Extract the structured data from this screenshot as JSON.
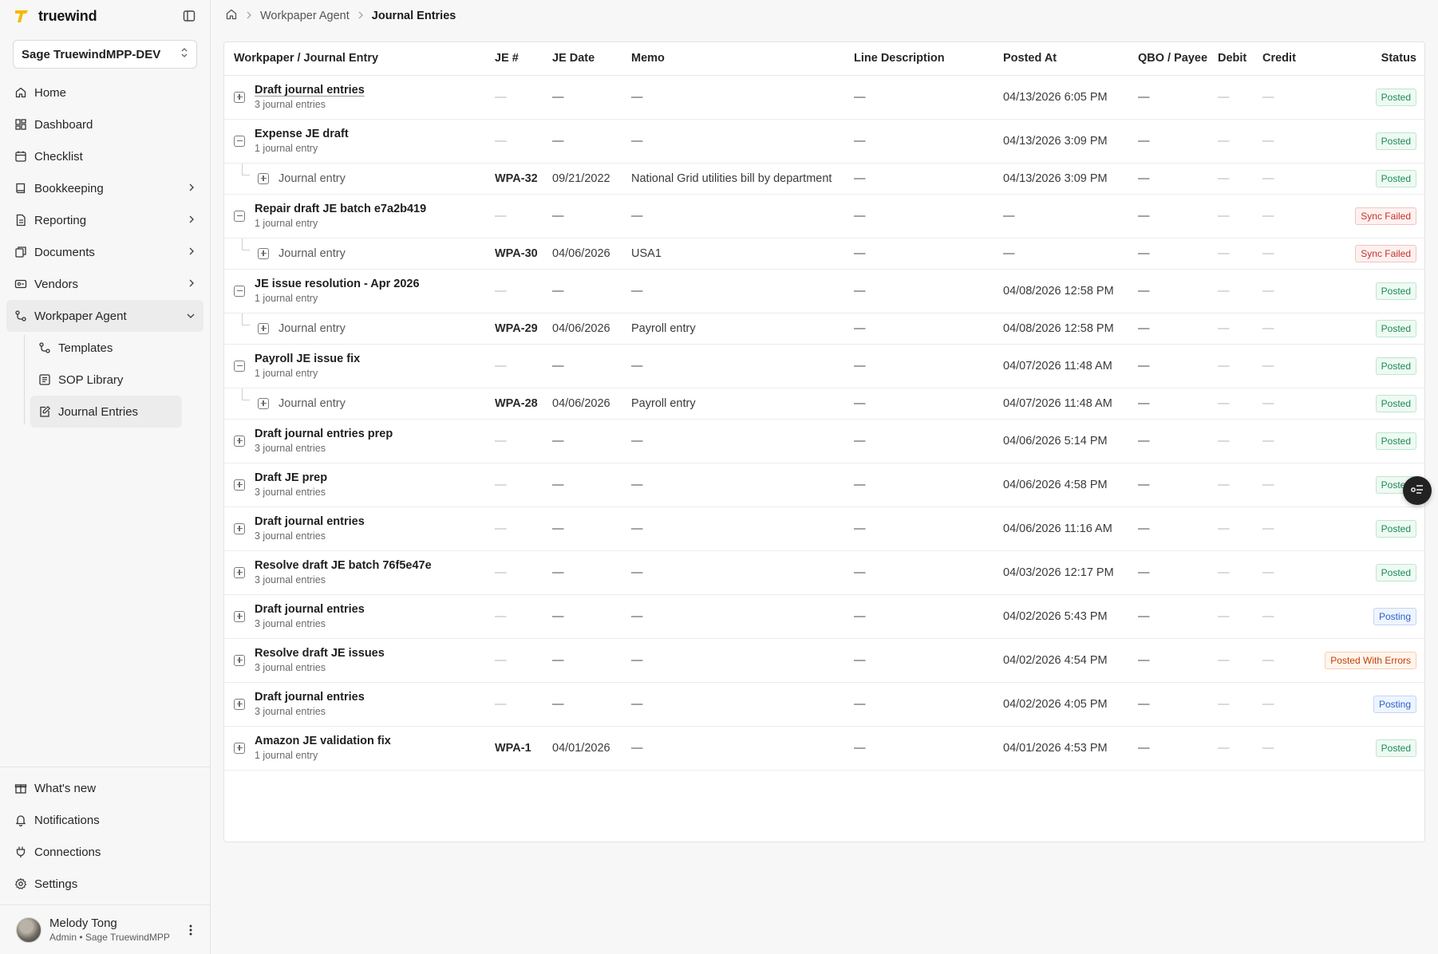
{
  "brand": {
    "name": "truewind",
    "accent": "#f5b800"
  },
  "org_select": {
    "value": "Sage TruewindMPP-DEV"
  },
  "nav": [
    {
      "label": "Home",
      "icon": "home-icon"
    },
    {
      "label": "Dashboard",
      "icon": "dashboard-icon"
    },
    {
      "label": "Checklist",
      "icon": "calendar-icon"
    },
    {
      "label": "Bookkeeping",
      "icon": "book-icon"
    },
    {
      "label": "Reporting",
      "icon": "report-icon"
    },
    {
      "label": "Documents",
      "icon": "documents-icon"
    },
    {
      "label": "Vendors",
      "icon": "vendors-icon"
    },
    {
      "label": "Workpaper Agent",
      "icon": "workpaper-agent-icon"
    }
  ],
  "subnav": [
    {
      "label": "Templates",
      "icon": "templates-icon"
    },
    {
      "label": "SOP Library",
      "icon": "sop-library-icon"
    },
    {
      "label": "Journal Entries",
      "icon": "journal-entries-icon"
    }
  ],
  "bottom_nav": [
    {
      "label": "What's new",
      "icon": "gift-icon"
    },
    {
      "label": "Notifications",
      "icon": "bell-icon"
    },
    {
      "label": "Connections",
      "icon": "plug-icon"
    },
    {
      "label": "Settings",
      "icon": "gear-icon"
    }
  ],
  "user": {
    "name": "Melody Tong",
    "role": "Admin • Sage TruewindMPP"
  },
  "breadcrumb": {
    "parent": "Workpaper Agent",
    "current": "Journal Entries"
  },
  "table": {
    "columns": [
      "Workpaper / Journal Entry",
      "JE #",
      "JE Date",
      "Memo",
      "Line Description",
      "Posted At",
      "QBO / Payee",
      "Debit",
      "Credit",
      "Status"
    ],
    "dash": "—",
    "rows": [
      {
        "kind": "parent",
        "expanded": false,
        "title": "Draft journal entries",
        "link": true,
        "sub": "3 journal entries",
        "je": "—",
        "date": "—",
        "memo": "—",
        "line": "—",
        "posted": "04/13/2026 6:05 PM",
        "qbo": "—",
        "debit": "—",
        "credit": "—",
        "status": "Posted",
        "status_type": "posted"
      },
      {
        "kind": "parent",
        "expanded": true,
        "title": "Expense JE draft",
        "sub": "1 journal entry",
        "je": "—",
        "date": "—",
        "memo": "—",
        "line": "—",
        "posted": "04/13/2026 3:09 PM",
        "qbo": "—",
        "debit": "—",
        "credit": "—",
        "status": "Posted",
        "status_type": "posted"
      },
      {
        "kind": "child",
        "title": "Journal entry",
        "je": "WPA-32",
        "date": "09/21/2022",
        "memo": "National Grid utilities bill by department",
        "line": "—",
        "posted": "04/13/2026 3:09 PM",
        "qbo": "—",
        "debit": "—",
        "credit": "—",
        "status": "Posted",
        "status_type": "posted"
      },
      {
        "kind": "parent",
        "expanded": true,
        "title": "Repair draft JE batch e7a2b419",
        "sub": "1 journal entry",
        "je": "—",
        "date": "—",
        "memo": "—",
        "line": "—",
        "posted": "—",
        "qbo": "—",
        "debit": "—",
        "credit": "—",
        "status": "Sync Failed",
        "status_type": "failed"
      },
      {
        "kind": "child",
        "title": "Journal entry",
        "je": "WPA-30",
        "date": "04/06/2026",
        "memo": "USA1",
        "line": "—",
        "posted": "—",
        "qbo": "—",
        "debit": "—",
        "credit": "—",
        "status": "Sync Failed",
        "status_type": "failed"
      },
      {
        "kind": "parent",
        "expanded": true,
        "title": "JE issue resolution - Apr 2026",
        "sub": "1 journal entry",
        "je": "—",
        "date": "—",
        "memo": "—",
        "line": "—",
        "posted": "04/08/2026 12:58 PM",
        "qbo": "—",
        "debit": "—",
        "credit": "—",
        "status": "Posted",
        "status_type": "posted"
      },
      {
        "kind": "child",
        "title": "Journal entry",
        "je": "WPA-29",
        "date": "04/06/2026",
        "memo": "Payroll entry",
        "line": "—",
        "posted": "04/08/2026 12:58 PM",
        "qbo": "—",
        "debit": "—",
        "credit": "—",
        "status": "Posted",
        "status_type": "posted"
      },
      {
        "kind": "parent",
        "expanded": true,
        "title": "Payroll JE issue fix",
        "sub": "1 journal entry",
        "je": "—",
        "date": "—",
        "memo": "—",
        "line": "—",
        "posted": "04/07/2026 11:48 AM",
        "qbo": "—",
        "debit": "—",
        "credit": "—",
        "status": "Posted",
        "status_type": "posted"
      },
      {
        "kind": "child",
        "title": "Journal entry",
        "je": "WPA-28",
        "date": "04/06/2026",
        "memo": "Payroll entry",
        "line": "—",
        "posted": "04/07/2026 11:48 AM",
        "qbo": "—",
        "debit": "—",
        "credit": "—",
        "status": "Posted",
        "status_type": "posted"
      },
      {
        "kind": "parent",
        "expanded": false,
        "title": "Draft journal entries prep",
        "sub": "3 journal entries",
        "je": "—",
        "date": "—",
        "memo": "—",
        "line": "—",
        "posted": "04/06/2026 5:14 PM",
        "qbo": "—",
        "debit": "—",
        "credit": "—",
        "status": "Posted",
        "status_type": "posted"
      },
      {
        "kind": "parent",
        "expanded": false,
        "title": "Draft JE prep",
        "sub": "3 journal entries",
        "je": "—",
        "date": "—",
        "memo": "—",
        "line": "—",
        "posted": "04/06/2026 4:58 PM",
        "qbo": "—",
        "debit": "—",
        "credit": "—",
        "status": "Posted",
        "status_type": "posted"
      },
      {
        "kind": "parent",
        "expanded": false,
        "title": "Draft journal entries",
        "sub": "3 journal entries",
        "je": "—",
        "date": "—",
        "memo": "—",
        "line": "—",
        "posted": "04/06/2026 11:16 AM",
        "qbo": "—",
        "debit": "—",
        "credit": "—",
        "status": "Posted",
        "status_type": "posted"
      },
      {
        "kind": "parent",
        "expanded": false,
        "title": "Resolve draft JE batch 76f5e47e",
        "sub": "3 journal entries",
        "je": "—",
        "date": "—",
        "memo": "—",
        "line": "—",
        "posted": "04/03/2026 12:17 PM",
        "qbo": "—",
        "debit": "—",
        "credit": "—",
        "status": "Posted",
        "status_type": "posted"
      },
      {
        "kind": "parent",
        "expanded": false,
        "title": "Draft journal entries",
        "sub": "3 journal entries",
        "je": "—",
        "date": "—",
        "memo": "—",
        "line": "—",
        "posted": "04/02/2026 5:43 PM",
        "qbo": "—",
        "debit": "—",
        "credit": "—",
        "status": "Posting",
        "status_type": "posting"
      },
      {
        "kind": "parent",
        "expanded": false,
        "title": "Resolve draft JE issues",
        "sub": "3 journal entries",
        "je": "—",
        "date": "—",
        "memo": "—",
        "line": "—",
        "posted": "04/02/2026 4:54 PM",
        "qbo": "—",
        "debit": "—",
        "credit": "—",
        "status": "Posted With Errors",
        "status_type": "errors"
      },
      {
        "kind": "parent",
        "expanded": false,
        "title": "Draft journal entries",
        "sub": "3 journal entries",
        "je": "—",
        "date": "—",
        "memo": "—",
        "line": "—",
        "posted": "04/02/2026 4:05 PM",
        "qbo": "—",
        "debit": "—",
        "credit": "—",
        "status": "Posting",
        "status_type": "posting"
      },
      {
        "kind": "parent",
        "expanded": false,
        "title": "Amazon JE validation fix",
        "sub": "1 journal entry",
        "je": "WPA-1",
        "date": "04/01/2026",
        "memo": "—",
        "line": "—",
        "posted": "04/01/2026 4:53 PM",
        "qbo": "—",
        "debit": "—",
        "credit": "—",
        "status": "Posted",
        "status_type": "posted"
      }
    ]
  },
  "colors": {
    "posted": "#1c8a55",
    "failed": "#c2332b",
    "posting": "#2c62c8",
    "errors": "#c2410c"
  }
}
